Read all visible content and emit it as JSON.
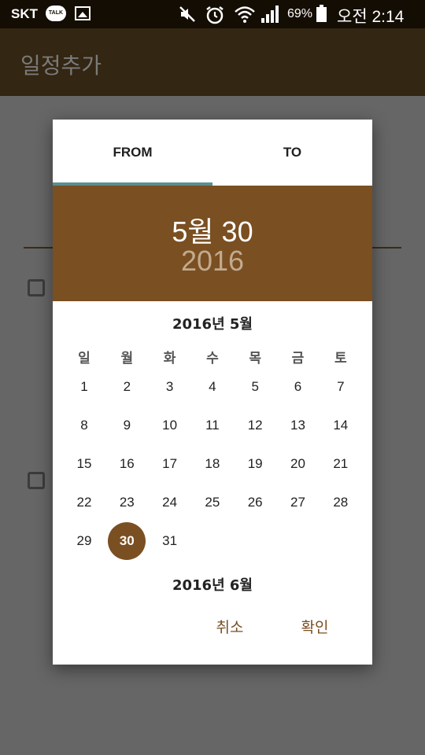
{
  "status_bar": {
    "carrier": "SKT",
    "talk_badge": "TALK",
    "battery_percent": "69%",
    "time": "오전 2:14",
    "icons": [
      "talk-icon",
      "gallery-icon",
      "mute-icon",
      "alarm-icon",
      "wifi-icon",
      "signal-icon",
      "battery-icon"
    ]
  },
  "app_bar": {
    "title": "일정추가"
  },
  "dialog": {
    "tabs": [
      {
        "label": "FROM",
        "selected": true
      },
      {
        "label": "TO",
        "selected": false
      }
    ],
    "header": {
      "date": "5월 30",
      "year": "2016"
    },
    "month_title": "2016년 5월",
    "next_month_title": "2016년 6월",
    "weekdays": [
      "일",
      "월",
      "화",
      "수",
      "목",
      "금",
      "토"
    ],
    "weeks": [
      [
        "1",
        "2",
        "3",
        "4",
        "5",
        "6",
        "7"
      ],
      [
        "8",
        "9",
        "10",
        "11",
        "12",
        "13",
        "14"
      ],
      [
        "15",
        "16",
        "17",
        "18",
        "19",
        "20",
        "21"
      ],
      [
        "22",
        "23",
        "24",
        "25",
        "26",
        "27",
        "28"
      ],
      [
        "29",
        "30",
        "31",
        "",
        "",
        "",
        ""
      ]
    ],
    "selected_day": "30",
    "cancel_label": "취소",
    "ok_label": "확인"
  },
  "colors": {
    "accent": "#7a4f22",
    "tab_indicator": "#5a8f91",
    "scrim": "#666666",
    "status_bar": "#140d04"
  }
}
